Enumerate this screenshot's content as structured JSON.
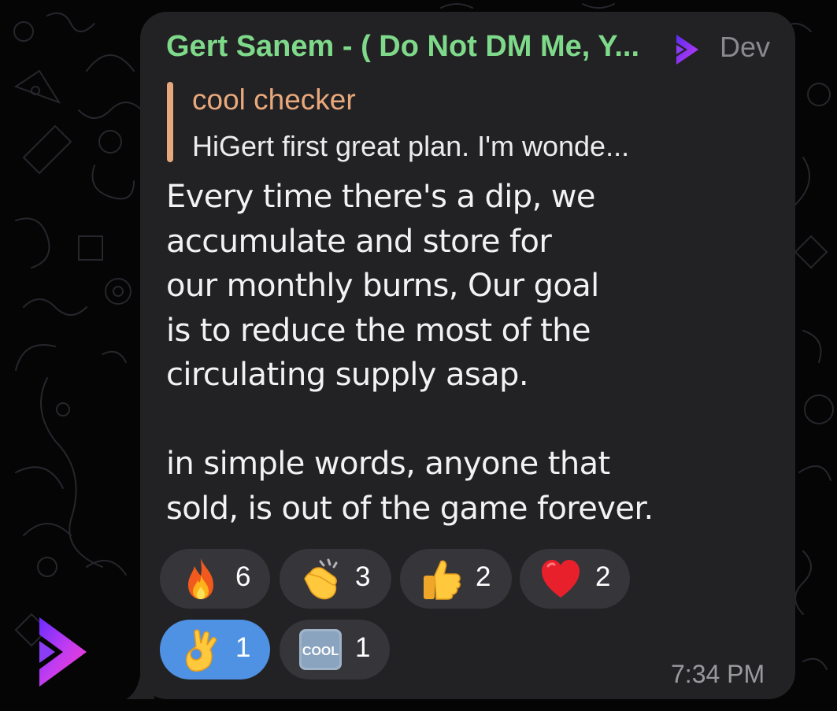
{
  "message": {
    "sender_name": "Gert Sanem - ( Do Not DM Me, Y...",
    "sender_role": "Dev",
    "reply": {
      "title": "cool checker",
      "text": "HiGert first great plan.  I'm wonde..."
    },
    "body": "Every time there's a dip, we\naccumulate and store for\nour monthly burns, Our goal\nis to reduce the most of the\ncirculating supply asap.\n\nin simple words, anyone that\nsold, is out of the game forever.",
    "time": "7:34 PM"
  },
  "reactions": [
    {
      "emoji": "fire-icon",
      "count": "6",
      "active": false
    },
    {
      "emoji": "clap-icon",
      "count": "3",
      "active": false
    },
    {
      "emoji": "thumbs-up-icon",
      "count": "2",
      "active": false
    },
    {
      "emoji": "heart-icon",
      "count": "2",
      "active": false
    },
    {
      "emoji": "ok-hand-icon",
      "count": "1",
      "active": true
    },
    {
      "emoji": "cool-icon",
      "count": "1",
      "active": false,
      "label": "COOL"
    }
  ],
  "colors": {
    "background": "#050506",
    "bubble": "#222224",
    "sender_name": "#7fd98a",
    "reply_accent": "#e8a87c",
    "reaction_active": "#4f91e3",
    "reaction_inactive": "#35353a",
    "brand_purple": "#8b3cf5"
  }
}
